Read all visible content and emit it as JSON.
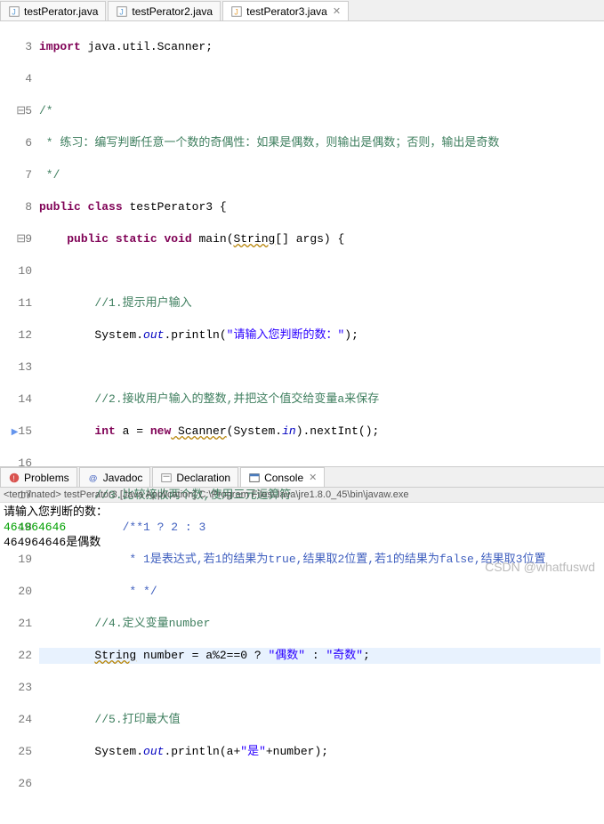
{
  "tabs": [
    {
      "label": "testPerator.java"
    },
    {
      "label": "testPerator2.java"
    },
    {
      "label": "testPerator3.java"
    }
  ],
  "lines": {
    "3": {
      "import": "import",
      "pkg": " java.util.Scanner;"
    },
    "5": "/*",
    "6": " * 练习：编写判断任意一个数的奇偶性：如果是偶数，则输出是偶数；否则，输出是奇数",
    "7": " */",
    "8": {
      "pub": "public",
      "cls": "class",
      "name": " testPerator3 {"
    },
    "9": {
      "pub": "public",
      "stat": "static",
      "vd": "void",
      "main": " main(",
      "str": "String",
      "rest": "[] args) {"
    },
    "11": "//1.提示用户输入",
    "12": {
      "sys": "System.",
      "out": "out",
      "pr": ".println(",
      "s": "\"请输入您判断的数：\"",
      "end": ");"
    },
    "14": "//2.接收用户输入的整数,并把这个值交给变量a来保存",
    "15": {
      "int": "int",
      "a": " a = ",
      "nw": "new",
      "scan": " Scanner",
      "p1": "(System.",
      "in": "in",
      "p2": ").nextInt();"
    },
    "16_cmt": "//3.比较接收两个数,使用三元运算符",
    "17": "/**1 ? 2 : 3",
    "18": " * 1是表达式,若1的结果为true,结果取2位置,若1的结果为false,结果取3位置",
    "19": " * */",
    "20": "//4.定义变量number",
    "21": {
      "str": "String",
      "rest": " number = a%2==0 ? ",
      "s1": "\"偶数\"",
      "mid": " : ",
      "s2": "\"奇数\"",
      "end": ";"
    },
    "24": "//5.打印最大值",
    "25": {
      "sys": "System.",
      "out": "out",
      "pr": ".println(a+",
      "s": "\"是\"",
      "end": "+number);"
    }
  },
  "gutter": [
    "3",
    "4",
    "5",
    "6",
    "7",
    "8",
    "9",
    "10",
    "11",
    "12",
    "13",
    "14",
    "15",
    "16",
    "17",
    "18",
    "19",
    "20",
    "21",
    "22",
    "23",
    "24",
    "25",
    "26"
  ],
  "bottom_tabs": {
    "problems": "Problems",
    "javadoc": "Javadoc",
    "declaration": "Declaration",
    "console": "Console"
  },
  "console_status": "<terminated> testPerator3 [Java Application] C:\\Program Files\\Java\\jre1.8.0_45\\bin\\javaw.exe",
  "console": {
    "l1": "请输入您判断的数：",
    "l2": "464964646",
    "l3": "464964646是偶数"
  },
  "watermark": "CSDN @whatfuswd"
}
